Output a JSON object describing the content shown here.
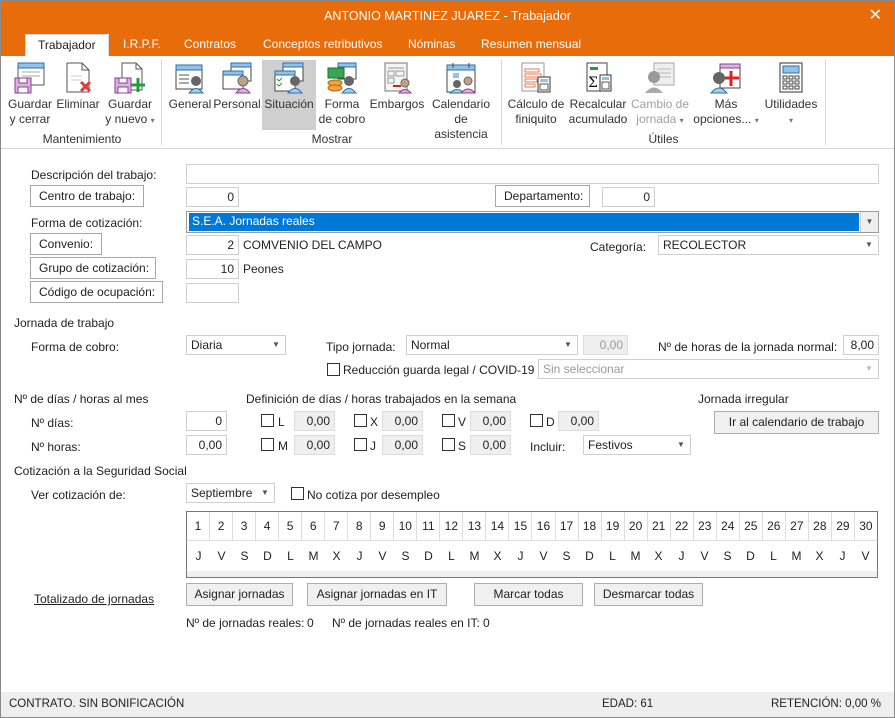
{
  "window": {
    "title": "ANTONIO MARTINEZ JUAREZ - Trabajador",
    "close_label": "✕"
  },
  "tabs": [
    {
      "label": "Trabajador",
      "active": true
    },
    {
      "label": "I.R.P.F.",
      "active": false
    },
    {
      "label": "Contratos",
      "active": false
    },
    {
      "label": "Conceptos retributivos",
      "active": false
    },
    {
      "label": "Nóminas",
      "active": false
    },
    {
      "label": "Resumen mensual",
      "active": false
    }
  ],
  "ribbon": {
    "groups": {
      "mantenimiento": "Mantenimiento",
      "mostrar": "Mostrar",
      "utiles": "Útiles"
    },
    "buttons": {
      "guardar_cerrar": {
        "line1": "Guardar",
        "line2": "y cerrar",
        "icon": "save-close-icon"
      },
      "eliminar": {
        "line1": "Eliminar",
        "line2": "",
        "icon": "delete-doc-icon"
      },
      "guardar_nuevo": {
        "line1": "Guardar",
        "line2": "y nuevo",
        "icon": "save-new-icon"
      },
      "general": {
        "line1": "General",
        "line2": "",
        "icon": "worker-general-icon"
      },
      "personal": {
        "line1": "Personal",
        "line2": "",
        "icon": "worker-personal-icon"
      },
      "situacion": {
        "line1": "Situación",
        "line2": "",
        "icon": "worker-situation-icon",
        "selected": true
      },
      "forma_cobro": {
        "line1": "Forma",
        "line2": "de cobro",
        "icon": "payment-method-icon"
      },
      "embargos": {
        "line1": "Embargos",
        "line2": "",
        "icon": "garnishment-icon"
      },
      "calendario": {
        "line1": "Calendario",
        "line2": "de asistencia",
        "icon": "attendance-calendar-icon"
      },
      "finiquito": {
        "line1": "Cálculo de",
        "line2": "finiquito",
        "icon": "settlement-calc-icon"
      },
      "recalcular": {
        "line1": "Recalcular",
        "line2": "acumulado",
        "icon": "sigma-calc-icon"
      },
      "cambio_jornada": {
        "line1": "Cambio de",
        "line2": "jornada",
        "icon": "shift-change-icon",
        "disabled": true
      },
      "mas_opciones": {
        "line1": "Más",
        "line2": "opciones...",
        "icon": "more-options-icon"
      },
      "utilidades": {
        "line1": "Utilidades",
        "line2": "",
        "icon": "calculator-icon"
      }
    },
    "dropdown_caret": "▾"
  },
  "form": {
    "descripcion": {
      "label": "Descripción del trabajo:",
      "value": ""
    },
    "centro": {
      "label": "Centro de trabajo:",
      "value": "0"
    },
    "departamento": {
      "label": "Departamento:",
      "value": "0"
    },
    "forma_cotizacion": {
      "label": "Forma de cotización:",
      "value": "S.E.A. Jornadas reales"
    },
    "convenio": {
      "label": "Convenio:",
      "value": "2",
      "name": "COMVENIO DEL CAMPO"
    },
    "categoria": {
      "label": "Categoría:",
      "value": "RECOLECTOR"
    },
    "grupo": {
      "label": "Grupo de cotización:",
      "value": "10",
      "name": "Peones"
    },
    "codigo_ocupacion": {
      "label": "Código de ocupación:",
      "value": ""
    }
  },
  "jornada": {
    "section": "Jornada de trabajo",
    "forma_cobro": {
      "label": "Forma de cobro:",
      "value": "Diaria"
    },
    "tipo_jornada": {
      "label": "Tipo jornada:",
      "value": "Normal",
      "extra": "0,00"
    },
    "horas_normal": {
      "label": "Nº de horas de la jornada normal:",
      "value": "8,00"
    },
    "reduccion": {
      "label": "Reducción guarda legal / COVID-19",
      "checked": false,
      "select_placeholder": "Sin seleccionar"
    }
  },
  "dias_horas": {
    "section": "Nº de días / horas al mes",
    "dias": {
      "label": "Nº días:",
      "value": "0"
    },
    "horas": {
      "label": "Nº horas:",
      "value": "0,00"
    }
  },
  "semana": {
    "section": "Definición de días / horas trabajados en la semana",
    "days": [
      {
        "label": "L",
        "value": "0,00",
        "checked": false
      },
      {
        "label": "M",
        "value": "0,00",
        "checked": false
      },
      {
        "label": "X",
        "value": "0,00",
        "checked": false
      },
      {
        "label": "J",
        "value": "0,00",
        "checked": false
      },
      {
        "label": "V",
        "value": "0,00",
        "checked": false
      },
      {
        "label": "S",
        "value": "0,00",
        "checked": false
      },
      {
        "label": "D",
        "value": "0,00",
        "checked": false
      }
    ],
    "incluir": {
      "label": "Incluir:",
      "value": "Festivos"
    }
  },
  "irregular": {
    "section": "Jornada irregular",
    "button": "Ir al calendario de trabajo"
  },
  "cotizacion": {
    "section": "Cotización a la Seguridad Social",
    "ver_label": "Ver cotización de:",
    "mes": "Septiembre",
    "no_cotiza": {
      "label": "No cotiza por desempleo",
      "checked": false
    },
    "days": [
      "1",
      "2",
      "3",
      "4",
      "5",
      "6",
      "7",
      "8",
      "9",
      "10",
      "11",
      "12",
      "13",
      "14",
      "15",
      "16",
      "17",
      "18",
      "19",
      "20",
      "21",
      "22",
      "23",
      "24",
      "25",
      "26",
      "27",
      "28",
      "29",
      "30"
    ],
    "weekdays": [
      "J",
      "V",
      "S",
      "D",
      "L",
      "M",
      "X",
      "J",
      "V",
      "S",
      "D",
      "L",
      "M",
      "X",
      "J",
      "V",
      "S",
      "D",
      "L",
      "M",
      "X",
      "J",
      "V",
      "S",
      "D",
      "L",
      "M",
      "X",
      "J",
      "V"
    ],
    "totalizado_link": "Totalizado de jornadas",
    "buttons": {
      "asignar": "Asignar jornadas",
      "asignar_it": "Asignar jornadas en IT",
      "marcar": "Marcar todas",
      "desmarcar": "Desmarcar todas"
    },
    "jornadas_reales": {
      "label": "Nº de jornadas reales:",
      "value": "0"
    },
    "jornadas_it": {
      "label": "Nº de jornadas reales en IT:",
      "value": "0"
    }
  },
  "status": {
    "contrato": "CONTRATO.  SIN BONIFICACIÓN",
    "edad": "EDAD: 61",
    "retencion": "RETENCIÓN: 0,00 %"
  },
  "colors": {
    "accent": "#e96c0a",
    "selection": "#0078d7"
  }
}
